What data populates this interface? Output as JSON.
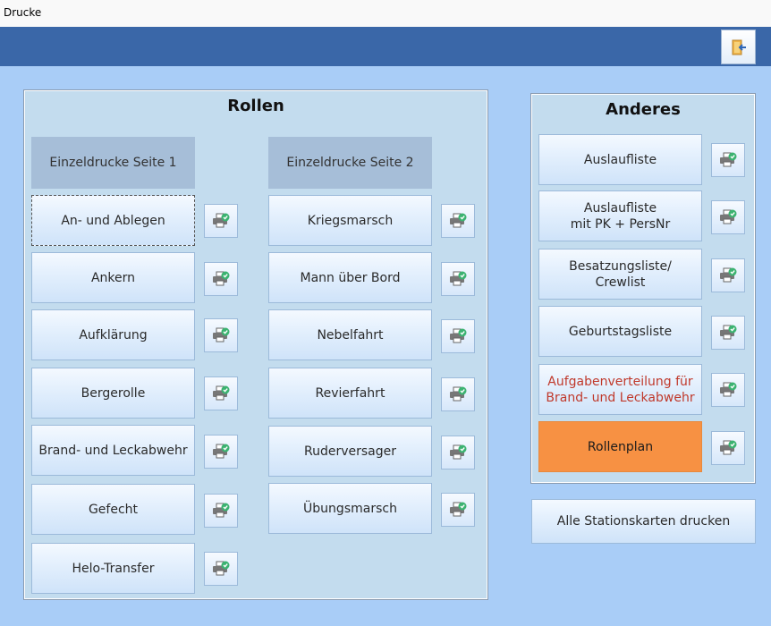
{
  "window": {
    "title": "Drucke"
  },
  "header": {
    "exit_icon": "exit-door-icon"
  },
  "rollen": {
    "title": "Rollen",
    "col1": {
      "header": "Einzeldrucke Seite 1",
      "items": [
        "An- und Ablegen",
        "Ankern",
        "Aufklärung",
        "Bergerolle",
        "Brand- und Leckabwehr",
        "Gefecht",
        "Helo-Transfer"
      ]
    },
    "col2": {
      "header": "Einzeldrucke Seite 2",
      "items": [
        "Kriegsmarsch",
        "Mann über Bord",
        "Nebelfahrt",
        "Revierfahrt",
        "Ruderversager",
        "Übungsmarsch"
      ]
    }
  },
  "anderes": {
    "title": "Anderes",
    "items": [
      "Auslaufliste",
      "Auslaufliste\nmit PK + PersNr",
      "Besatzungsliste/\nCrewlist",
      "Geburtstagsliste",
      "Aufgabenverteilung für\nBrand- und Leckabwehr",
      "Rollenplan"
    ]
  },
  "all_stations": "Alle Stationskarten drucken",
  "colors": {
    "accent_orange": "#f79143",
    "header_blue": "#3a67a8",
    "warning_red": "#c0392b"
  },
  "icons": {
    "print": "printer-check-icon"
  }
}
